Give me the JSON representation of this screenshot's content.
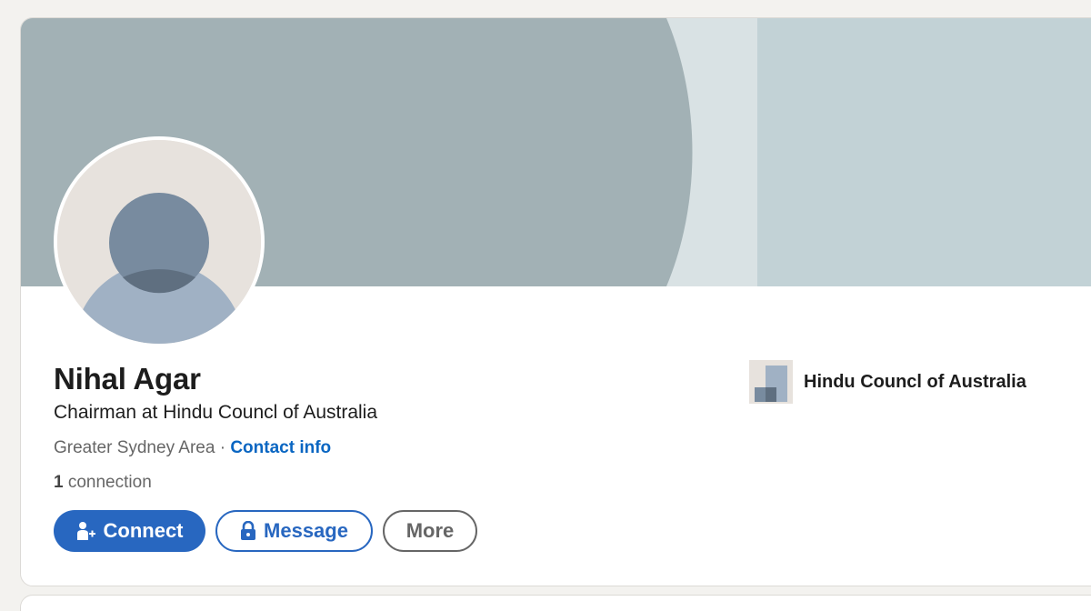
{
  "profile": {
    "name": "Nihal Agar",
    "headline": "Chairman at Hindu Councl of Australia",
    "location": "Greater Sydney Area",
    "separator": " · ",
    "contact_info_label": "Contact info",
    "connections_count": "1",
    "connections_label": " connection"
  },
  "actions": {
    "connect_label": "Connect",
    "connect_icon": "add-person-icon",
    "message_label": "Message",
    "message_icon": "lock-icon",
    "more_label": "More"
  },
  "company": {
    "name": "Hindu Councl of Australia",
    "logo_icon": "company-building-logo"
  },
  "colors": {
    "primary_blue": "#2867c0",
    "banner_dark": "#a2b1b5",
    "banner_light": "#c2d2d6",
    "banner_stripe": "#d9e2e4",
    "avatar_head": "#788b9f",
    "avatar_body": "#a0b1c4",
    "avatar_bg": "#e7e2dd"
  }
}
